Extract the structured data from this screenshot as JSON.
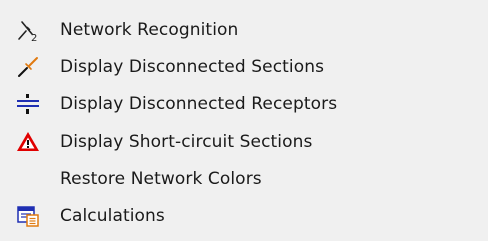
{
  "menu": {
    "items": [
      {
        "label": "Network Recognition",
        "icon": "network-recognition-icon"
      },
      {
        "label": "Display Disconnected Sections",
        "icon": "disconnected-sections-icon"
      },
      {
        "label": "Display Disconnected Receptors",
        "icon": "disconnected-receptors-icon"
      },
      {
        "label": "Display Short-circuit Sections",
        "icon": "warning-triangle-icon"
      },
      {
        "label": "Restore Network Colors",
        "icon": ""
      },
      {
        "label": "Calculations",
        "icon": "calculations-icon"
      }
    ]
  },
  "colors": {
    "menu_background": "#f0f0f0",
    "text": "#1a1a1a",
    "warning_red": "#e00000",
    "receptor_blue": "#1f2fb3",
    "section_orange": "#e07a10"
  }
}
